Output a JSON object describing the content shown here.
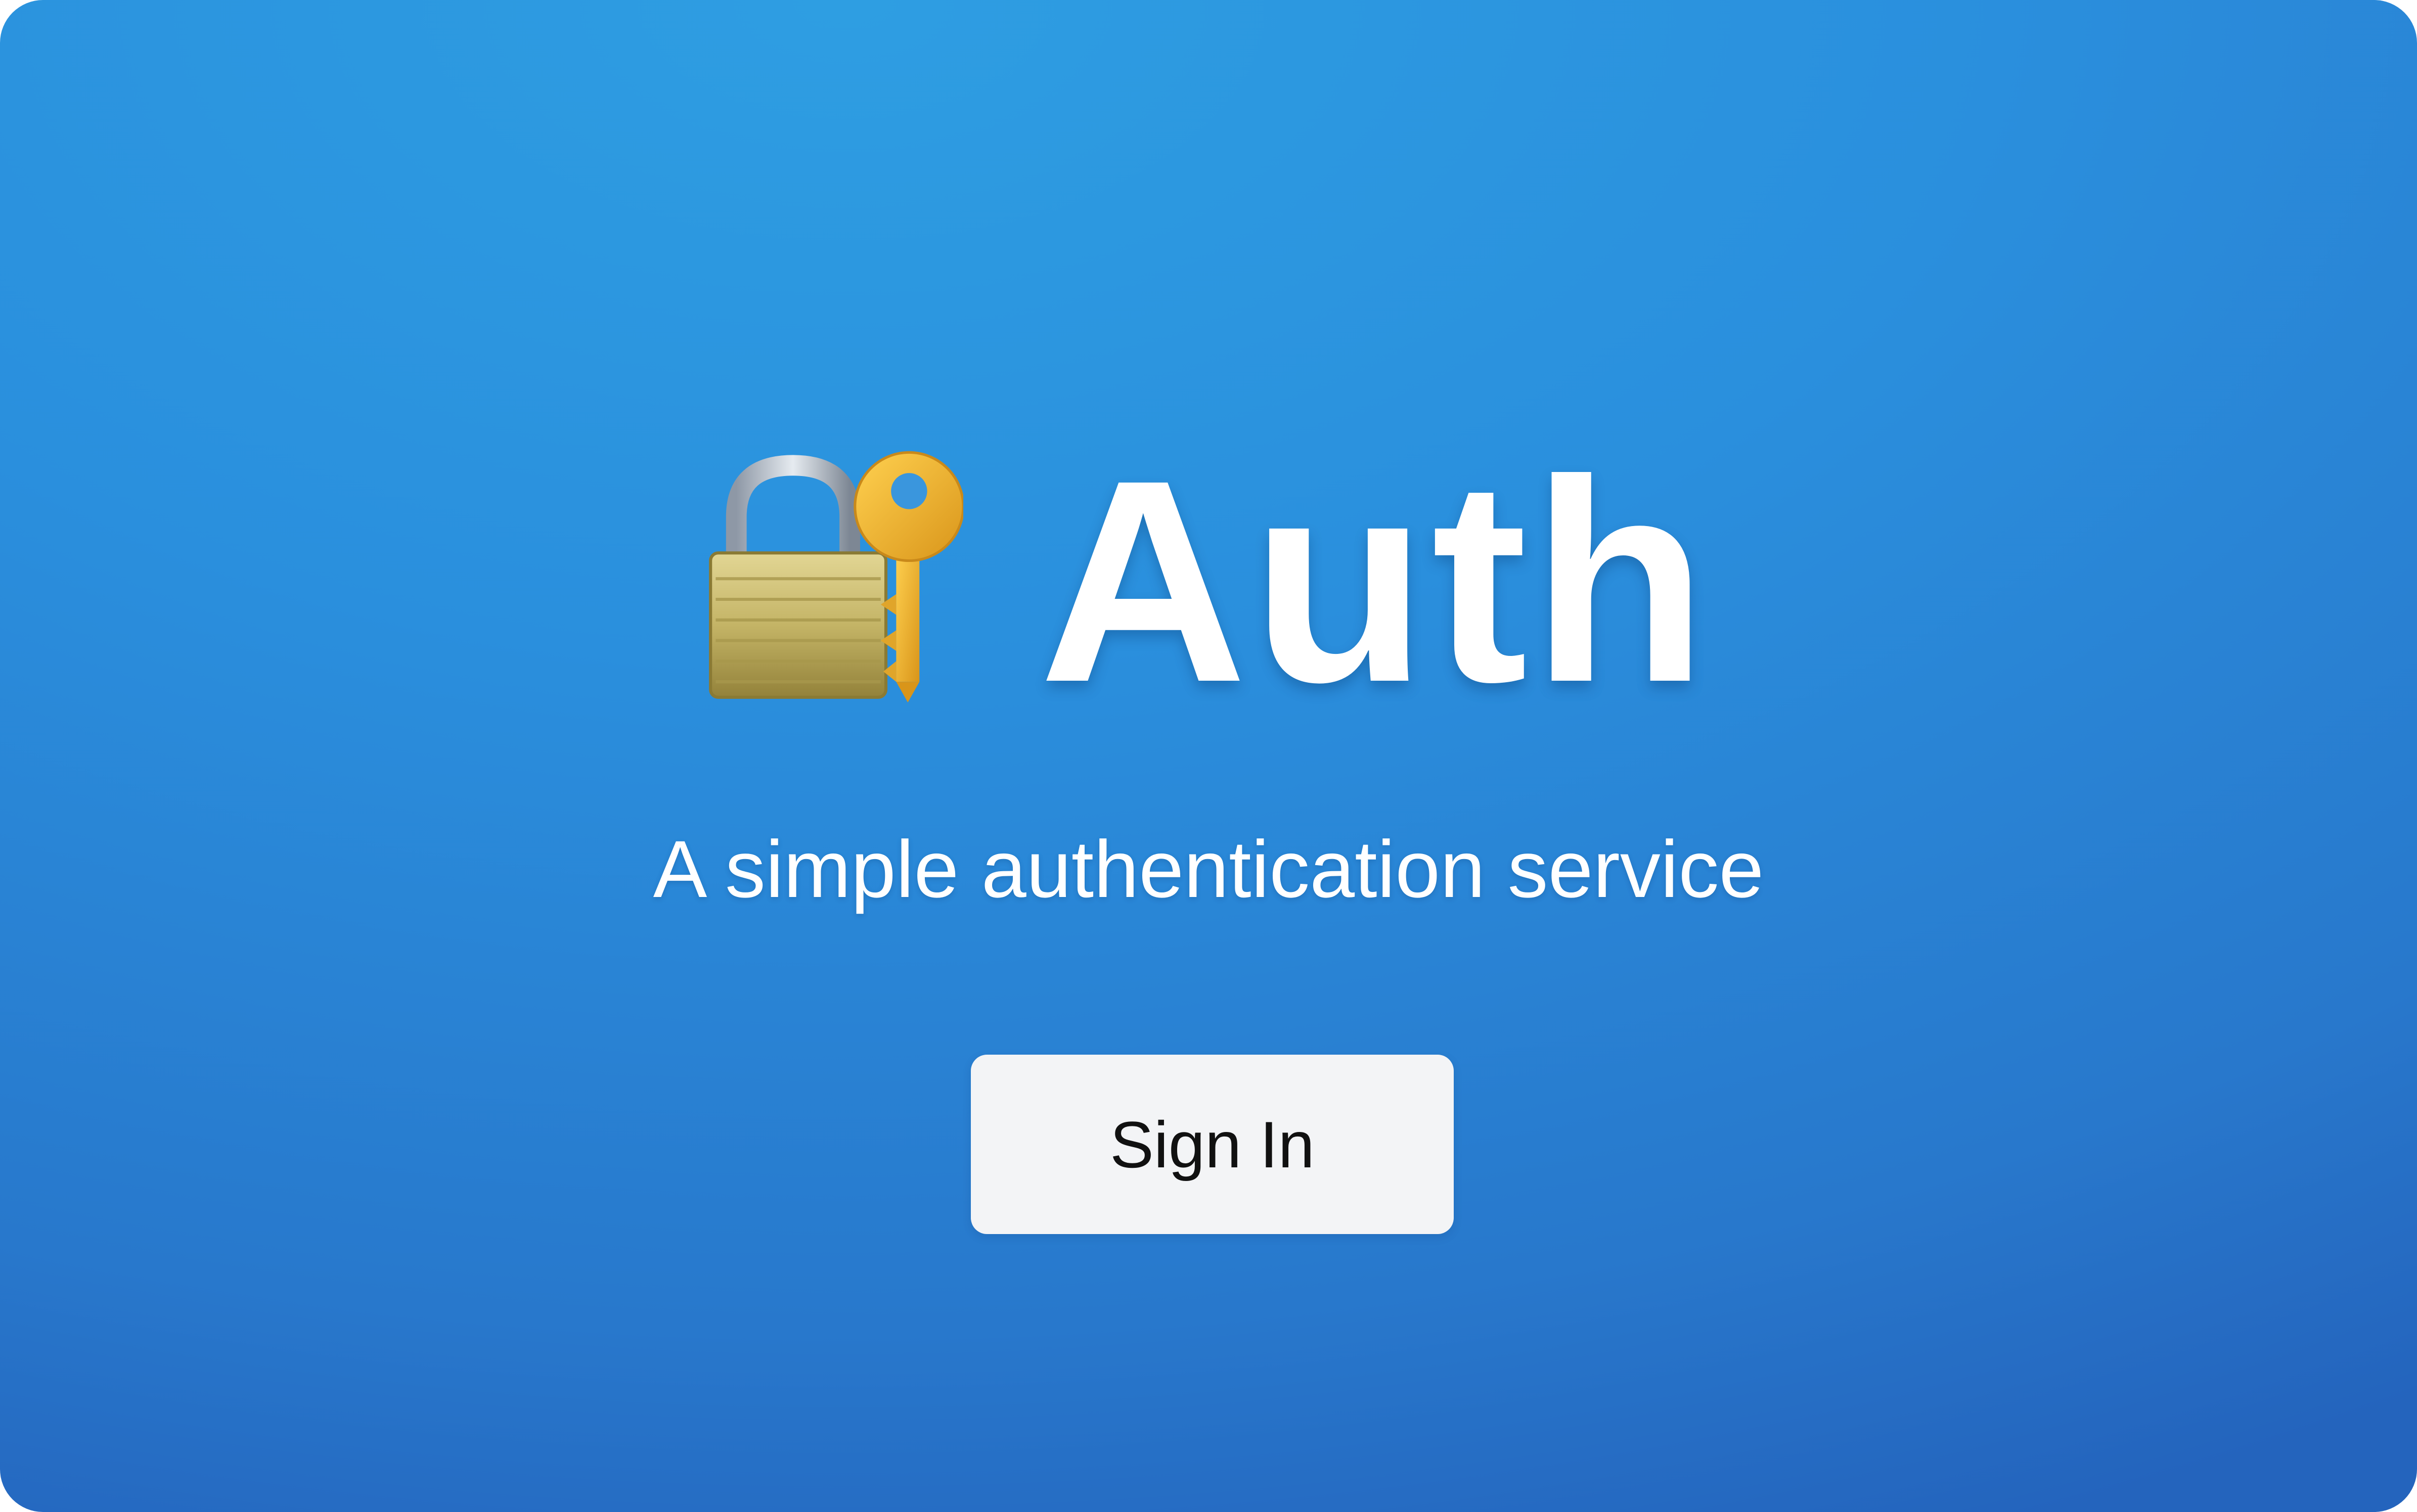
{
  "app": {
    "title": "Auth",
    "tagline": "A simple authentication service",
    "icon": "locked-with-key-icon"
  },
  "actions": {
    "sign_in_label": "Sign In"
  },
  "colors": {
    "background_top": "#2e9ee2",
    "background_bottom": "#2464bd",
    "button_background": "#f3f4f6",
    "button_text": "#111111",
    "title_text": "#ffffff"
  }
}
